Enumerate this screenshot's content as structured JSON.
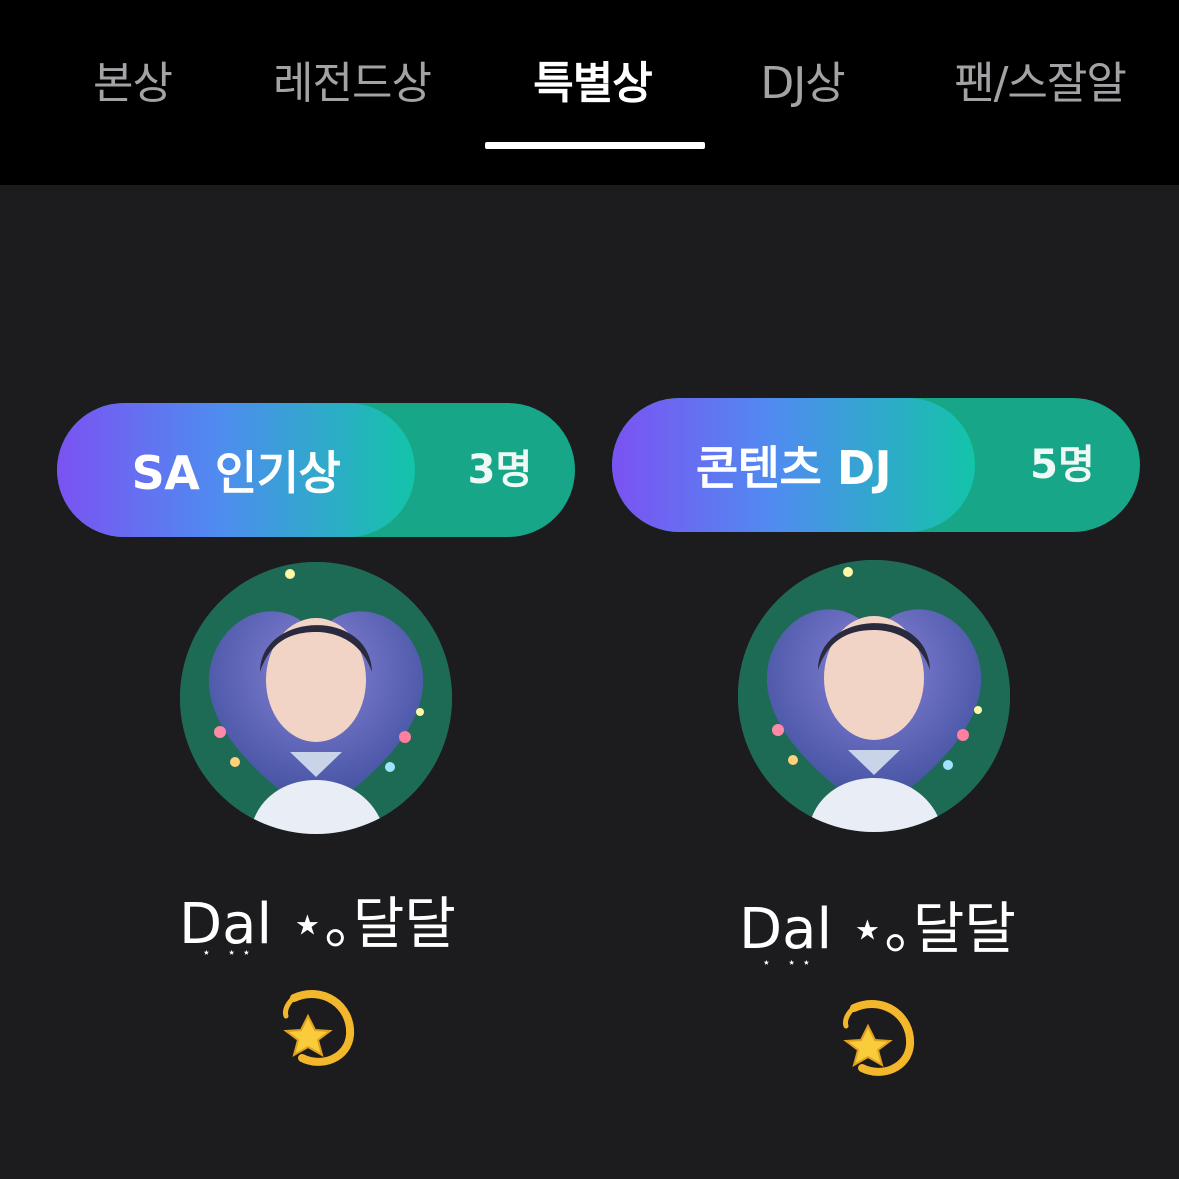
{
  "tabs": [
    {
      "label": "본상",
      "active": false
    },
    {
      "label": "레전드상",
      "active": false
    },
    {
      "label": "특별상",
      "active": true
    },
    {
      "label": "DJ상",
      "active": false
    },
    {
      "label": "팬/스잘알",
      "active": false
    }
  ],
  "awards": [
    {
      "title": "SA 인기상",
      "count": "3명",
      "winner": {
        "name": "Dal ⋆｡달달",
        "stars": "⋆ ⋆⋆",
        "emoji_icon": "dizzy-star-icon"
      }
    },
    {
      "title": "콘텐츠 DJ",
      "count": "5명",
      "winner": {
        "name": "Dal ⋆｡달달",
        "stars": "⋆ ⋆⋆",
        "emoji_icon": "dizzy-star-icon"
      }
    }
  ],
  "colors": {
    "top_bar": "#000000",
    "background": "#1c1b1d",
    "pill_gradient_start": "#7b52f2",
    "pill_gradient_end": "#13c4a9",
    "pill_count_bg": "#17a688"
  }
}
